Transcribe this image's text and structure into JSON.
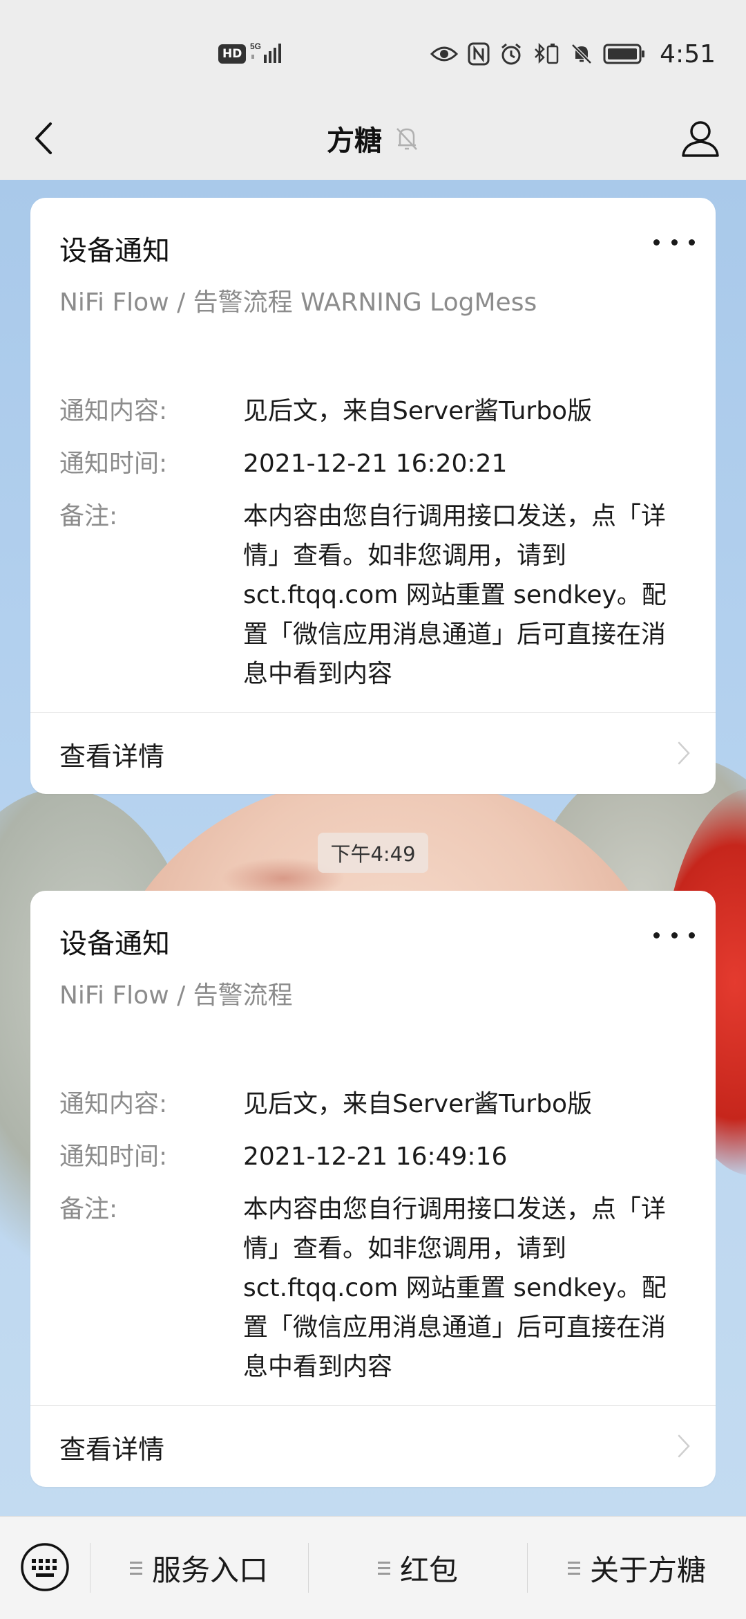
{
  "status_bar": {
    "hd": "HD",
    "network": "5G",
    "time": "4:51"
  },
  "nav": {
    "title": "方糖",
    "back_icon": "chevron-left-icon",
    "mute_icon": "bell-muted-icon",
    "profile_icon": "person-icon"
  },
  "messages": [
    {
      "title": "设备通知",
      "subtitle": "NiFi Flow / 告警流程 WARNING LogMess",
      "fields": [
        {
          "label": "通知内容:",
          "value": "见后文，来自Server酱Turbo版"
        },
        {
          "label": "通知时间:",
          "value": "2021-12-21 16:20:21"
        },
        {
          "label": "备注:",
          "value": "本内容由您自行调用接口发送，点「详情」查看。如非您调用，请到 sct.ftqq.com 网站重置 sendkey。配置「微信应用消息通道」后可直接在消息中看到内容"
        }
      ],
      "footer": "查看详情"
    },
    {
      "title": "设备通知",
      "subtitle": "NiFi Flow / 告警流程",
      "fields": [
        {
          "label": "通知内容:",
          "value": "见后文，来自Server酱Turbo版"
        },
        {
          "label": "通知时间:",
          "value": "2021-12-21 16:49:16"
        },
        {
          "label": "备注:",
          "value": "本内容由您自行调用接口发送，点「详情」查看。如非您调用，请到 sct.ftqq.com 网站重置 sendkey。配置「微信应用消息通道」后可直接在消息中看到内容"
        }
      ],
      "footer": "查看详情"
    }
  ],
  "timestamp": "下午4:49",
  "bottom_menu": {
    "keyboard_icon": "keyboard-icon",
    "items": [
      {
        "label": "服务入口"
      },
      {
        "label": "红包"
      },
      {
        "label": "关于方糖"
      }
    ]
  },
  "colors": {
    "page_bg": "#ededed",
    "card_bg": "#ffffff",
    "muted_text": "#8c8c8c",
    "chat_bg": "#b5d2ef"
  }
}
